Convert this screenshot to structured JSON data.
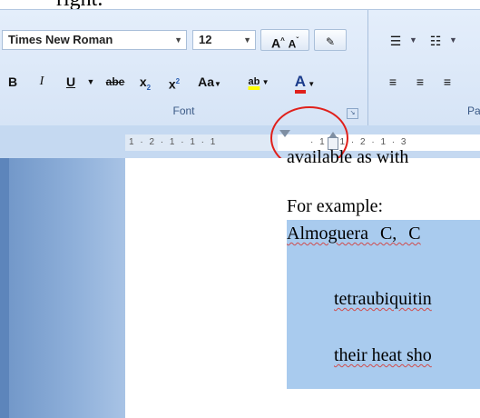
{
  "top_text": "right.",
  "ribbon": {
    "font_group": {
      "label": "Font",
      "font_name": "Times New Roman",
      "font_size": "12",
      "grow_font": "A",
      "shrink_font": "A",
      "bold": "B",
      "italic": "I",
      "underline": "U",
      "strikethrough": "abe",
      "subscript": "x",
      "superscript": "x",
      "change_case": "Aa",
      "highlight": "ab",
      "font_color": "A",
      "highlight_color": "#ffff00",
      "font_color_swatch": "#e0201b"
    },
    "paragraph_group": {
      "label": "Pa"
    }
  },
  "ruler": {
    "left_numbers": "1 · 2 · 1 · 1 · 1",
    "right_numbers": "· 1 · 1 · 2 · 1 · 3"
  },
  "document": {
    "partial_line": "available as with",
    "example_label": "For example:",
    "line1": "Almoguera C, C",
    "line2": "tetraubiquitin",
    "line3": "their heat sho"
  },
  "colors": {
    "selection": "#a9cbee",
    "annotation_circle": "#e0201b"
  }
}
